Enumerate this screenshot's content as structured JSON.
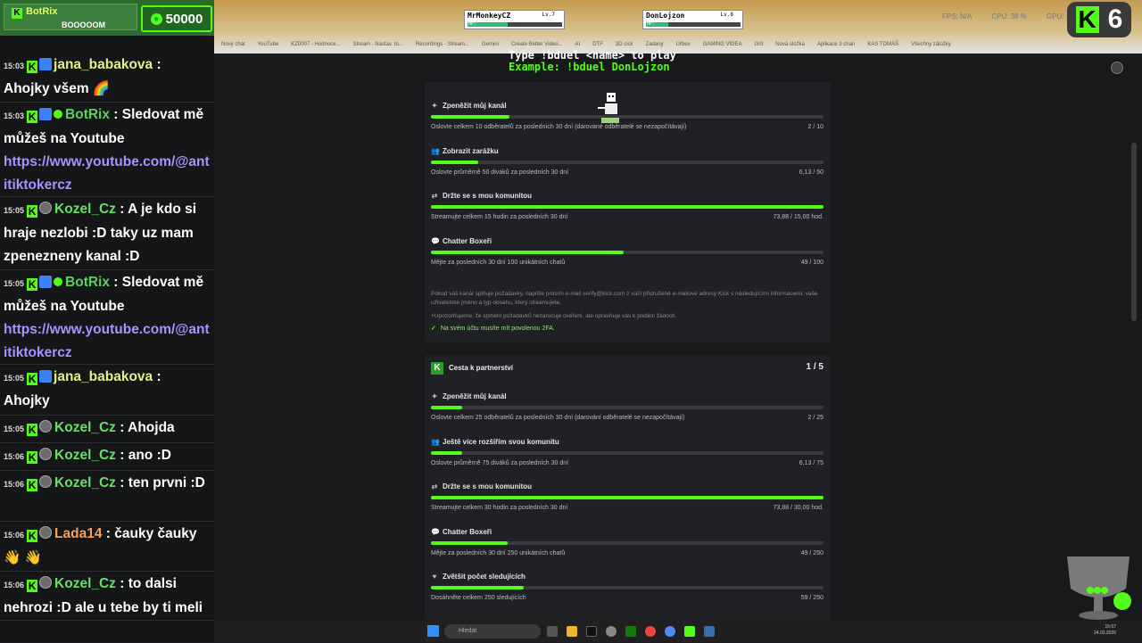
{
  "stream_overlay": {
    "botrix_label": "BotRix",
    "botrix_subtext": "BOOOOOM",
    "coins": "50000",
    "game_hint_line1": "Type !bduel <name> to play",
    "game_hint_line2": "Example: !bduel DonLojzon",
    "players": [
      {
        "name": "MrMonkeyCZ",
        "level": "Lv.7",
        "hp_label": "HP:",
        "hp": 0.42
      },
      {
        "name": "DonLojzon",
        "level": "Lv.8",
        "hp_label": "HP:",
        "hp": 0.24
      }
    ],
    "badge_number": "6",
    "badge_letter": "K"
  },
  "browser": {
    "stats": [
      "FPS: N/A",
      "CPU: 38 %",
      "GPU: 1 %"
    ],
    "bookmarks": [
      "Nový chat",
      "YouTube",
      "KZ0007 - Hodnoce...",
      "Stream - Nastav. to...",
      "Recordings - Stream...",
      "Gemini",
      "Create Better Video...",
      "AI",
      "DTF",
      "3D cick",
      "Zadany",
      "Urbex",
      "GAMING VIDEA",
      "Grit",
      "Nová složka",
      "Aplikace 3 chan",
      "KAS TOMÁŠ",
      "Všechny záložky"
    ]
  },
  "chat": {
    "messages": [
      {
        "time": "15:03",
        "user": "jana_babakova",
        "text": "Ahojky všem 🌈",
        "style": "jana"
      },
      {
        "time": "15:03",
        "user": "BotRix",
        "text": "Sledovat mě můžeš na Youtube",
        "link": "https://www.youtube.com/@antitiktokercz",
        "style": "botrix"
      },
      {
        "time": "15:05",
        "user": "Kozel_Cz",
        "text": "A je kdo si hraje nezlobi :D taky uz mam zpenezneny kanal :D",
        "style": "kozel"
      },
      {
        "time": "15:05",
        "user": "BotRix",
        "text": "Sledovat mě můžeš na Youtube",
        "link": "https://www.youtube.com/@antitiktokercz",
        "style": "botrix"
      },
      {
        "time": "15:05",
        "user": "jana_babakova",
        "text": "Ahojky",
        "style": "jana"
      },
      {
        "time": "15:05",
        "user": "Kozel_Cz",
        "text": "Ahojda",
        "style": "kozel"
      },
      {
        "time": "15:06",
        "user": "Kozel_Cz",
        "text": "ano :D",
        "style": "kozel"
      },
      {
        "time": "15:06",
        "user": "Kozel_Cz",
        "text": "ten prvni :D",
        "style": "kozel"
      },
      {
        "time": "15:06",
        "user": "Lada14",
        "text": "čauky čauky 👋 👋",
        "style": "lada"
      },
      {
        "time": "15:06",
        "user": "Kozel_Cz",
        "text": "to dalsi nehrozi :D ale u tebe by ti meli pomoc kluci :D",
        "style": "kozel"
      }
    ]
  },
  "affiliate": {
    "requirements": [
      {
        "icon": "coin-icon",
        "title": "Zpeněžit můj kanál",
        "desc": "Oslovte celkem 10 odběratelů za posledních 30 dní (darované odběratelé se nezapočítávají)",
        "value": "2 / 10",
        "progress": 0.2
      },
      {
        "icon": "users-icon",
        "title": "Zobrazit zarážku",
        "desc": "Oslovte průměrně 50 diváků za posledních 30 dní",
        "value": "6,13 / 50",
        "progress": 0.12
      },
      {
        "icon": "handshake-icon",
        "title": "Držte se s mou komunitou",
        "desc": "Streamujte celkem 15 hodin za posledních 30 dní",
        "value": "73,88 / 15,00 hod.",
        "progress": 1.0
      },
      {
        "icon": "chat-icon",
        "title": "Chatter Boxeři",
        "desc": "Mějte za posledních 30 dní 100 unikátních chatů",
        "value": "49 / 100",
        "progress": 0.49
      }
    ],
    "note1": "Pokud váš kanál splňuje požadavky, napište prosím e-mail verify@kick.com z vaší přidružené e-mailové adresy Kick s následujícími informacemi: vaše uživatelské jméno a typ obsahu, který streamujete.",
    "note2": "+Upozorňujeme, že splnění požadavků nezaručuje ověření, ale opravňuje vás k podání žádosti.",
    "twofa": "Na svém účtu musíte mít povolenou 2FA."
  },
  "partner": {
    "title": "Cesta k partnerství",
    "count": "1 / 5",
    "requirements": [
      {
        "icon": "coin-icon",
        "title": "Zpeněžit můj kanál",
        "desc": "Oslovte celkem 25 odběratelů za posledních 30 dní (darování odběratelé se nezapočítávají)",
        "value": "2 / 25",
        "progress": 0.08
      },
      {
        "icon": "users-icon",
        "title": "Ještě více rozšířím svou komunitu",
        "desc": "Oslovte průměrně 75 diváků za posledních 30 dní",
        "value": "6,13 / 75",
        "progress": 0.08
      },
      {
        "icon": "handshake-icon",
        "title": "Držte se s mou komunitou",
        "desc": "Streamujte celkem 30 hodin za posledních 30 dní",
        "value": "73,88 / 30,00 hod.",
        "progress": 1.0
      },
      {
        "icon": "chat-icon",
        "title": "Chatter Boxeři",
        "desc": "Mějte za posledních 30 dní 250 unikátních chatů",
        "value": "49 / 250",
        "progress": 0.196
      },
      {
        "icon": "heart-icon",
        "title": "Zvětšit počet sledujících",
        "desc": "Dosáhněte celkem 250 sledujících",
        "value": "59 / 250",
        "progress": 0.236
      }
    ]
  },
  "taskbar": {
    "search_placeholder": "Hledat",
    "time": "15:07",
    "date": "24.03.2026"
  },
  "colors": {
    "kick_green": "#53fc18",
    "bg": "#18191b",
    "card": "#202124"
  }
}
